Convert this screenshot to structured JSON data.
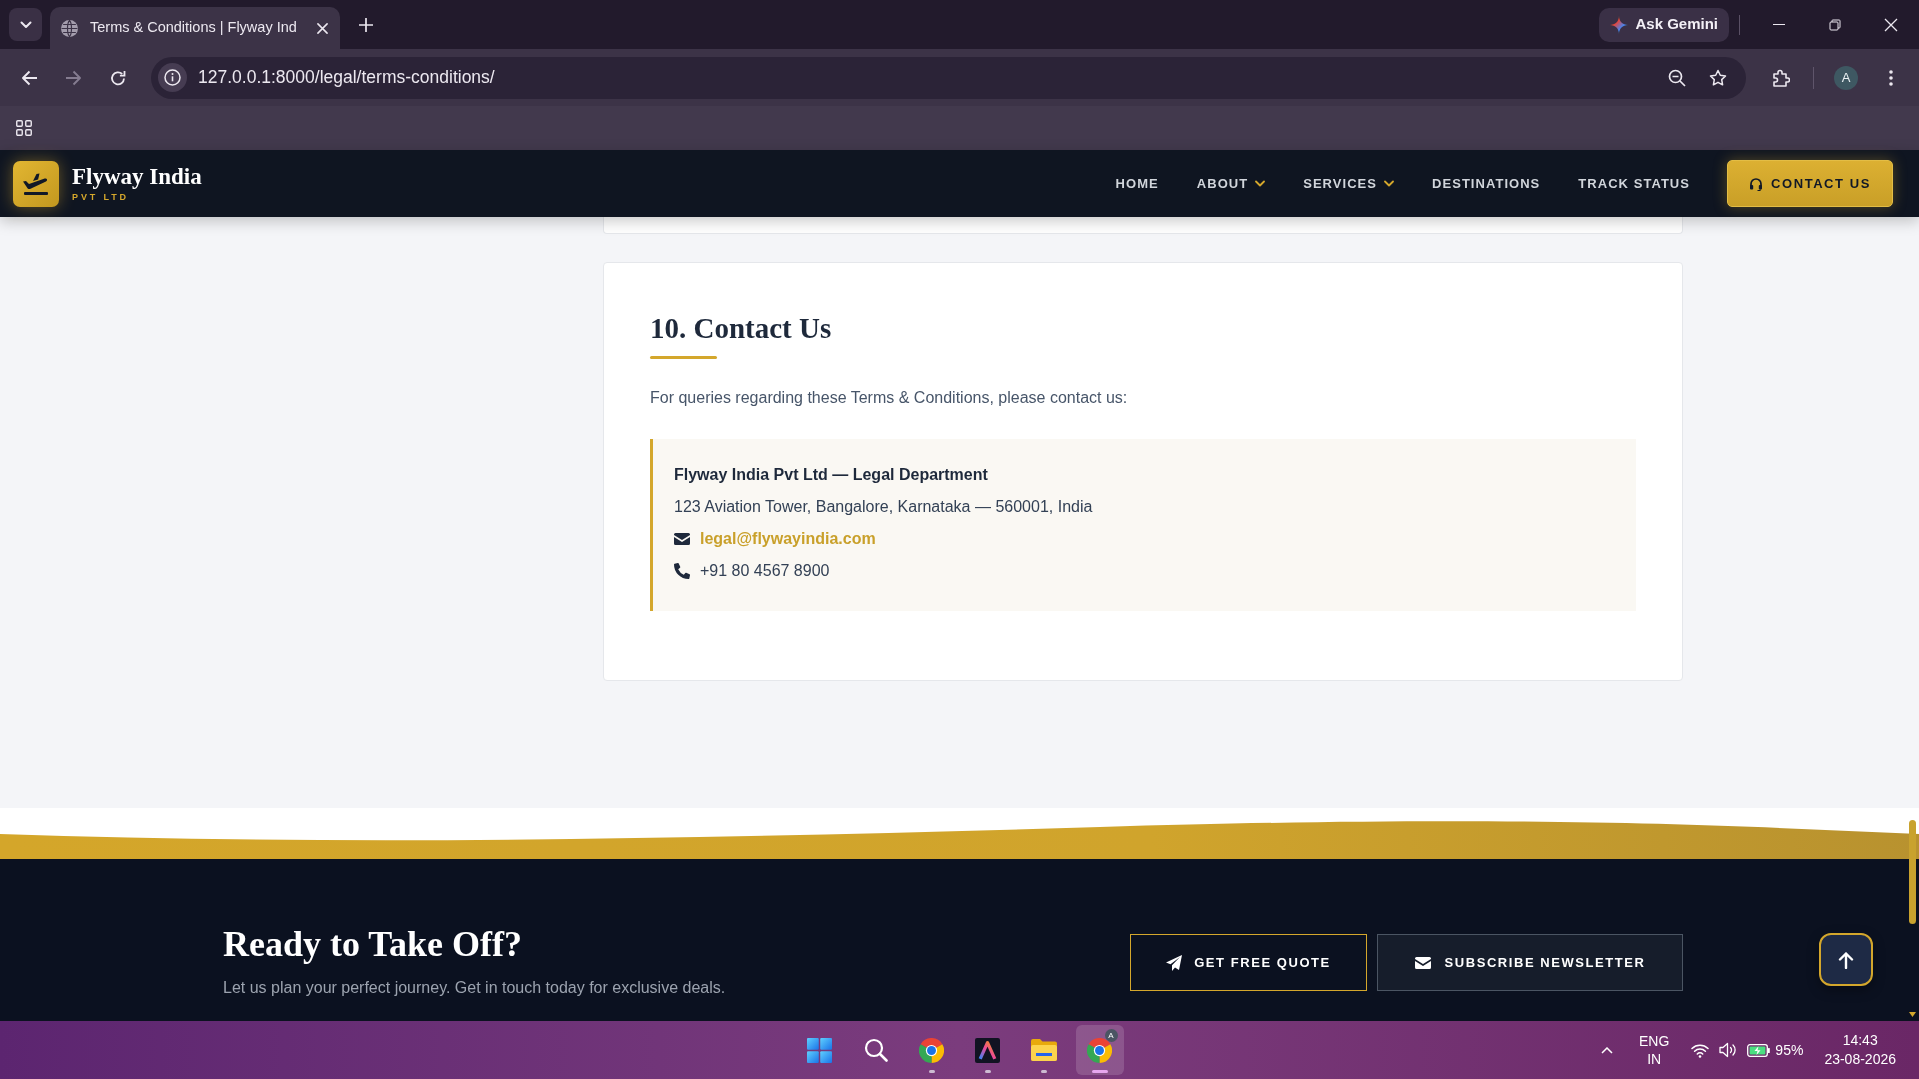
{
  "browser": {
    "tabs": [
      {
        "title": "Terms & Conditions | Flyway Ind",
        "selected": true
      }
    ],
    "assistant_button": "Ask Gemini",
    "forward_button": {
      "disabled": true
    },
    "url": "127.0.0.1:8000/legal/terms-conditions/",
    "profile_initial": "A"
  },
  "site_header": {
    "brand": "Flyway India",
    "tagline": "PVT LTD",
    "nav": [
      {
        "label": "HOME",
        "has_menu": false
      },
      {
        "label": "ABOUT",
        "has_menu": true
      },
      {
        "label": "SERVICES",
        "has_menu": true
      },
      {
        "label": "DESTINATIONS",
        "has_menu": false
      },
      {
        "label": "TRACK STATUS",
        "has_menu": false
      }
    ],
    "cta": "CONTACT US"
  },
  "section": {
    "heading": "10. Contact Us",
    "intro": "For queries regarding these Terms & Conditions, please contact us:",
    "contact_lines": [
      {
        "kind": "title",
        "text": "Flyway India Pvt Ltd — Legal Department"
      },
      {
        "kind": "address",
        "text": "123 Aviation Tower, Bangalore, Karnataka — 560001, India"
      },
      {
        "kind": "email",
        "text": "legal@flywayindia.com"
      },
      {
        "kind": "phone",
        "text": "+91 80 4567 8900"
      }
    ]
  },
  "footer_cta": {
    "title": "Ready to Take Off?",
    "subtitle": "Let us plan your perfect journey. Get in touch today for exclusive deals.",
    "buttons": [
      {
        "kind": "outline",
        "label": "GET FREE QUOTE"
      },
      {
        "kind": "filled",
        "label": "SUBSCRIBE NEWSLETTER"
      }
    ]
  },
  "taskbar": {
    "apps": [
      {
        "kind": "start",
        "running": false,
        "selected": false
      },
      {
        "kind": "search",
        "running": false,
        "selected": false
      },
      {
        "kind": "browser",
        "running": true,
        "selected": false
      },
      {
        "kind": "designer",
        "running": true,
        "selected": false
      },
      {
        "kind": "files",
        "running": true,
        "selected": false
      },
      {
        "kind": "browser",
        "running": true,
        "selected": true,
        "badge": "A"
      }
    ],
    "language": "ENG",
    "region": "IN",
    "battery": "95%",
    "time": "14:43",
    "date": "23-08-2026"
  }
}
